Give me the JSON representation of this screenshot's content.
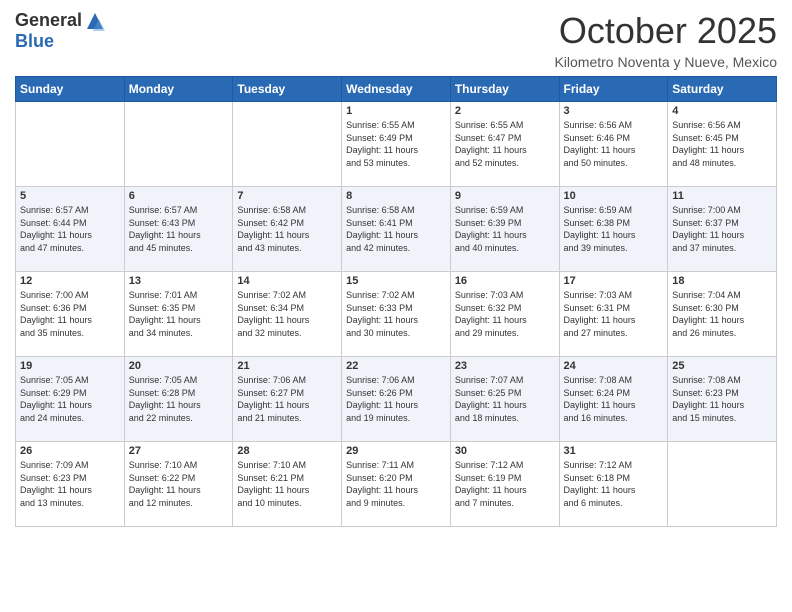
{
  "header": {
    "logo_general": "General",
    "logo_blue": "Blue",
    "month": "October 2025",
    "location": "Kilometro Noventa y Nueve, Mexico"
  },
  "days_of_week": [
    "Sunday",
    "Monday",
    "Tuesday",
    "Wednesday",
    "Thursday",
    "Friday",
    "Saturday"
  ],
  "weeks": [
    [
      {
        "day": "",
        "info": ""
      },
      {
        "day": "",
        "info": ""
      },
      {
        "day": "",
        "info": ""
      },
      {
        "day": "1",
        "info": "Sunrise: 6:55 AM\nSunset: 6:49 PM\nDaylight: 11 hours\nand 53 minutes."
      },
      {
        "day": "2",
        "info": "Sunrise: 6:55 AM\nSunset: 6:47 PM\nDaylight: 11 hours\nand 52 minutes."
      },
      {
        "day": "3",
        "info": "Sunrise: 6:56 AM\nSunset: 6:46 PM\nDaylight: 11 hours\nand 50 minutes."
      },
      {
        "day": "4",
        "info": "Sunrise: 6:56 AM\nSunset: 6:45 PM\nDaylight: 11 hours\nand 48 minutes."
      }
    ],
    [
      {
        "day": "5",
        "info": "Sunrise: 6:57 AM\nSunset: 6:44 PM\nDaylight: 11 hours\nand 47 minutes."
      },
      {
        "day": "6",
        "info": "Sunrise: 6:57 AM\nSunset: 6:43 PM\nDaylight: 11 hours\nand 45 minutes."
      },
      {
        "day": "7",
        "info": "Sunrise: 6:58 AM\nSunset: 6:42 PM\nDaylight: 11 hours\nand 43 minutes."
      },
      {
        "day": "8",
        "info": "Sunrise: 6:58 AM\nSunset: 6:41 PM\nDaylight: 11 hours\nand 42 minutes."
      },
      {
        "day": "9",
        "info": "Sunrise: 6:59 AM\nSunset: 6:39 PM\nDaylight: 11 hours\nand 40 minutes."
      },
      {
        "day": "10",
        "info": "Sunrise: 6:59 AM\nSunset: 6:38 PM\nDaylight: 11 hours\nand 39 minutes."
      },
      {
        "day": "11",
        "info": "Sunrise: 7:00 AM\nSunset: 6:37 PM\nDaylight: 11 hours\nand 37 minutes."
      }
    ],
    [
      {
        "day": "12",
        "info": "Sunrise: 7:00 AM\nSunset: 6:36 PM\nDaylight: 11 hours\nand 35 minutes."
      },
      {
        "day": "13",
        "info": "Sunrise: 7:01 AM\nSunset: 6:35 PM\nDaylight: 11 hours\nand 34 minutes."
      },
      {
        "day": "14",
        "info": "Sunrise: 7:02 AM\nSunset: 6:34 PM\nDaylight: 11 hours\nand 32 minutes."
      },
      {
        "day": "15",
        "info": "Sunrise: 7:02 AM\nSunset: 6:33 PM\nDaylight: 11 hours\nand 30 minutes."
      },
      {
        "day": "16",
        "info": "Sunrise: 7:03 AM\nSunset: 6:32 PM\nDaylight: 11 hours\nand 29 minutes."
      },
      {
        "day": "17",
        "info": "Sunrise: 7:03 AM\nSunset: 6:31 PM\nDaylight: 11 hours\nand 27 minutes."
      },
      {
        "day": "18",
        "info": "Sunrise: 7:04 AM\nSunset: 6:30 PM\nDaylight: 11 hours\nand 26 minutes."
      }
    ],
    [
      {
        "day": "19",
        "info": "Sunrise: 7:05 AM\nSunset: 6:29 PM\nDaylight: 11 hours\nand 24 minutes."
      },
      {
        "day": "20",
        "info": "Sunrise: 7:05 AM\nSunset: 6:28 PM\nDaylight: 11 hours\nand 22 minutes."
      },
      {
        "day": "21",
        "info": "Sunrise: 7:06 AM\nSunset: 6:27 PM\nDaylight: 11 hours\nand 21 minutes."
      },
      {
        "day": "22",
        "info": "Sunrise: 7:06 AM\nSunset: 6:26 PM\nDaylight: 11 hours\nand 19 minutes."
      },
      {
        "day": "23",
        "info": "Sunrise: 7:07 AM\nSunset: 6:25 PM\nDaylight: 11 hours\nand 18 minutes."
      },
      {
        "day": "24",
        "info": "Sunrise: 7:08 AM\nSunset: 6:24 PM\nDaylight: 11 hours\nand 16 minutes."
      },
      {
        "day": "25",
        "info": "Sunrise: 7:08 AM\nSunset: 6:23 PM\nDaylight: 11 hours\nand 15 minutes."
      }
    ],
    [
      {
        "day": "26",
        "info": "Sunrise: 7:09 AM\nSunset: 6:23 PM\nDaylight: 11 hours\nand 13 minutes."
      },
      {
        "day": "27",
        "info": "Sunrise: 7:10 AM\nSunset: 6:22 PM\nDaylight: 11 hours\nand 12 minutes."
      },
      {
        "day": "28",
        "info": "Sunrise: 7:10 AM\nSunset: 6:21 PM\nDaylight: 11 hours\nand 10 minutes."
      },
      {
        "day": "29",
        "info": "Sunrise: 7:11 AM\nSunset: 6:20 PM\nDaylight: 11 hours\nand 9 minutes."
      },
      {
        "day": "30",
        "info": "Sunrise: 7:12 AM\nSunset: 6:19 PM\nDaylight: 11 hours\nand 7 minutes."
      },
      {
        "day": "31",
        "info": "Sunrise: 7:12 AM\nSunset: 6:18 PM\nDaylight: 11 hours\nand 6 minutes."
      },
      {
        "day": "",
        "info": ""
      }
    ]
  ]
}
